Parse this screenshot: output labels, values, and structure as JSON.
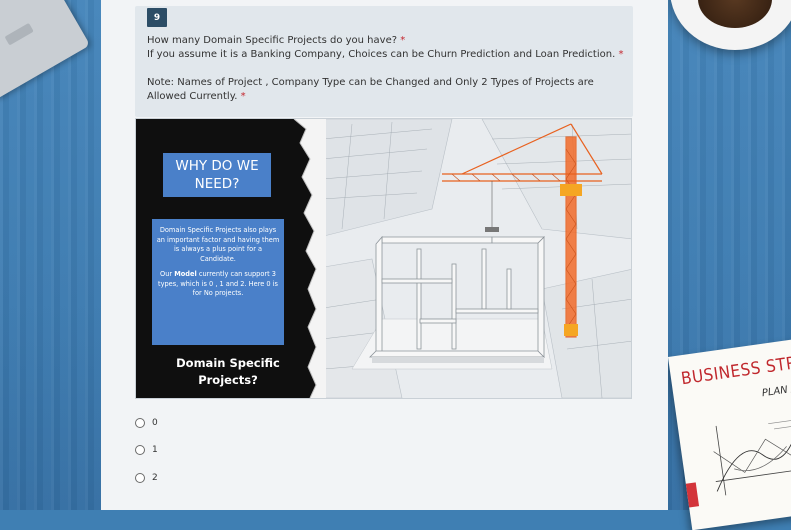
{
  "question": {
    "number": "9",
    "line1": "How many Domain Specific Projects do you have?",
    "line2": "If you assume it is a Banking Company, Choices can be Churn Prediction and Loan Prediction.",
    "note": "Note: Names of Project , Company Type can be Changed and Only 2 Types of Projects are Allowed Currently.",
    "required_mark": "*"
  },
  "image": {
    "why_title": "WHY DO WE NEED?",
    "desc_para1": "Domain Specific Projects also plays an important factor and having them is always a plus point for a Candidate.",
    "desc_para2_pre": "Our ",
    "desc_para2_bold": "Model",
    "desc_para2_post": " currently can support 3 types, which is 0 , 1 and 2. Here 0 is for No projects.",
    "footer_label": "Domain Specific Projects?"
  },
  "options": [
    {
      "label": "0",
      "selected": false
    },
    {
      "label": "1",
      "selected": false
    },
    {
      "label": "2",
      "selected": false
    }
  ],
  "background": {
    "book_title": "BUSINESS STRATEG",
    "book_subtitle": "PLAN A"
  },
  "colors": {
    "desk": "#3f7fb3",
    "card": "#f2f4f6",
    "question_bg": "#e1e7ec",
    "badge": "#2c4d66",
    "required": "#c4262e",
    "info_box": "#4a80c9",
    "crane": "#f26b2a"
  }
}
